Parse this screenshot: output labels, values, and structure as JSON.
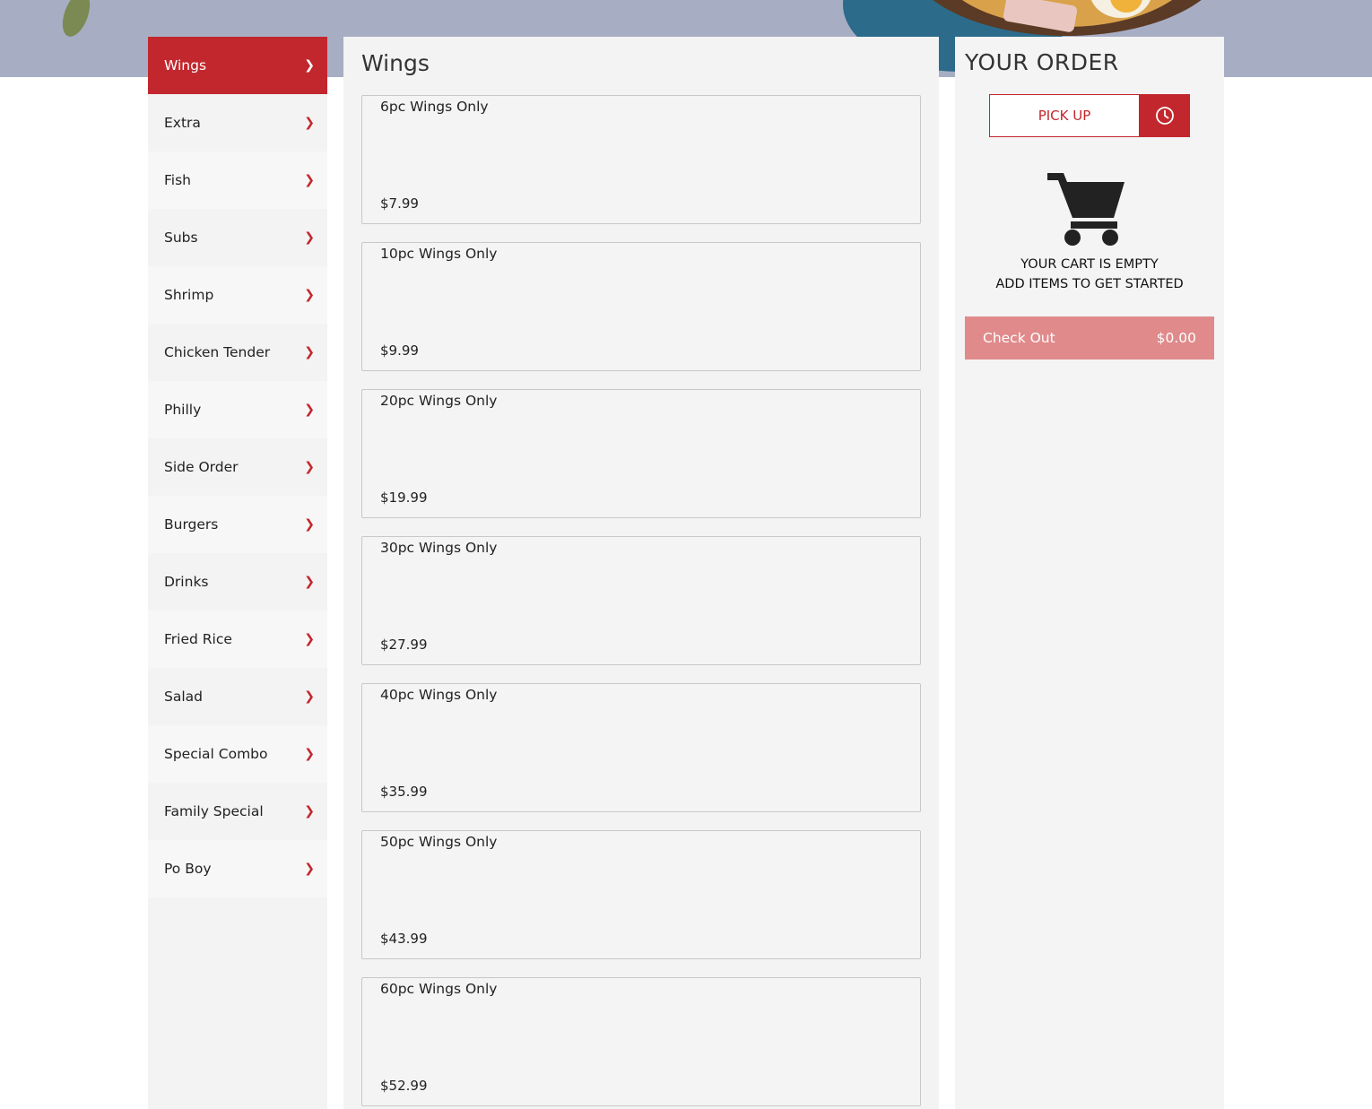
{
  "colors": {
    "accent": "#c2272d",
    "checkout_bg": "#e08a8b",
    "panel_bg": "#f3f3f3"
  },
  "categories": [
    {
      "label": "Wings",
      "icon": "chevron-right-icon",
      "active": true
    },
    {
      "label": "Extra",
      "icon": "chevron-right-icon"
    },
    {
      "label": "Fish",
      "icon": "chevron-right-icon"
    },
    {
      "label": "Subs",
      "icon": "chevron-right-icon"
    },
    {
      "label": "Shrimp",
      "icon": "chevron-right-icon"
    },
    {
      "label": "Chicken Tender",
      "icon": "chevron-right-icon"
    },
    {
      "label": "Philly",
      "icon": "chevron-right-icon"
    },
    {
      "label": "Side Order",
      "icon": "chevron-right-icon"
    },
    {
      "label": "Burgers",
      "icon": "chevron-right-icon"
    },
    {
      "label": "Drinks",
      "icon": "chevron-right-icon"
    },
    {
      "label": "Fried Rice",
      "icon": "chevron-right-icon"
    },
    {
      "label": "Salad",
      "icon": "chevron-right-icon"
    },
    {
      "label": "Special Combo",
      "icon": "chevron-right-icon"
    },
    {
      "label": "Family Special",
      "icon": "chevron-right-icon"
    },
    {
      "label": "Po Boy",
      "icon": "chevron-right-icon"
    }
  ],
  "menu": {
    "title": "Wings",
    "items": [
      {
        "name": "6pc Wings Only",
        "price": "$7.99"
      },
      {
        "name": "10pc Wings Only",
        "price": "$9.99"
      },
      {
        "name": "20pc Wings Only",
        "price": "$19.99"
      },
      {
        "name": "30pc Wings Only",
        "price": "$27.99"
      },
      {
        "name": "40pc Wings Only",
        "price": "$35.99"
      },
      {
        "name": "50pc Wings Only",
        "price": "$43.99"
      },
      {
        "name": "60pc Wings Only",
        "price": "$52.99"
      }
    ]
  },
  "order": {
    "title": "YOUR ORDER",
    "pickup_label": "PICK UP",
    "pickup_time_icon": "clock-icon",
    "cart_icon": "shopping-cart-icon",
    "empty_line1": "YOUR CART IS EMPTY",
    "empty_line2": "ADD ITEMS TO GET STARTED",
    "checkout_label": "Check Out",
    "checkout_total": "$0.00"
  }
}
